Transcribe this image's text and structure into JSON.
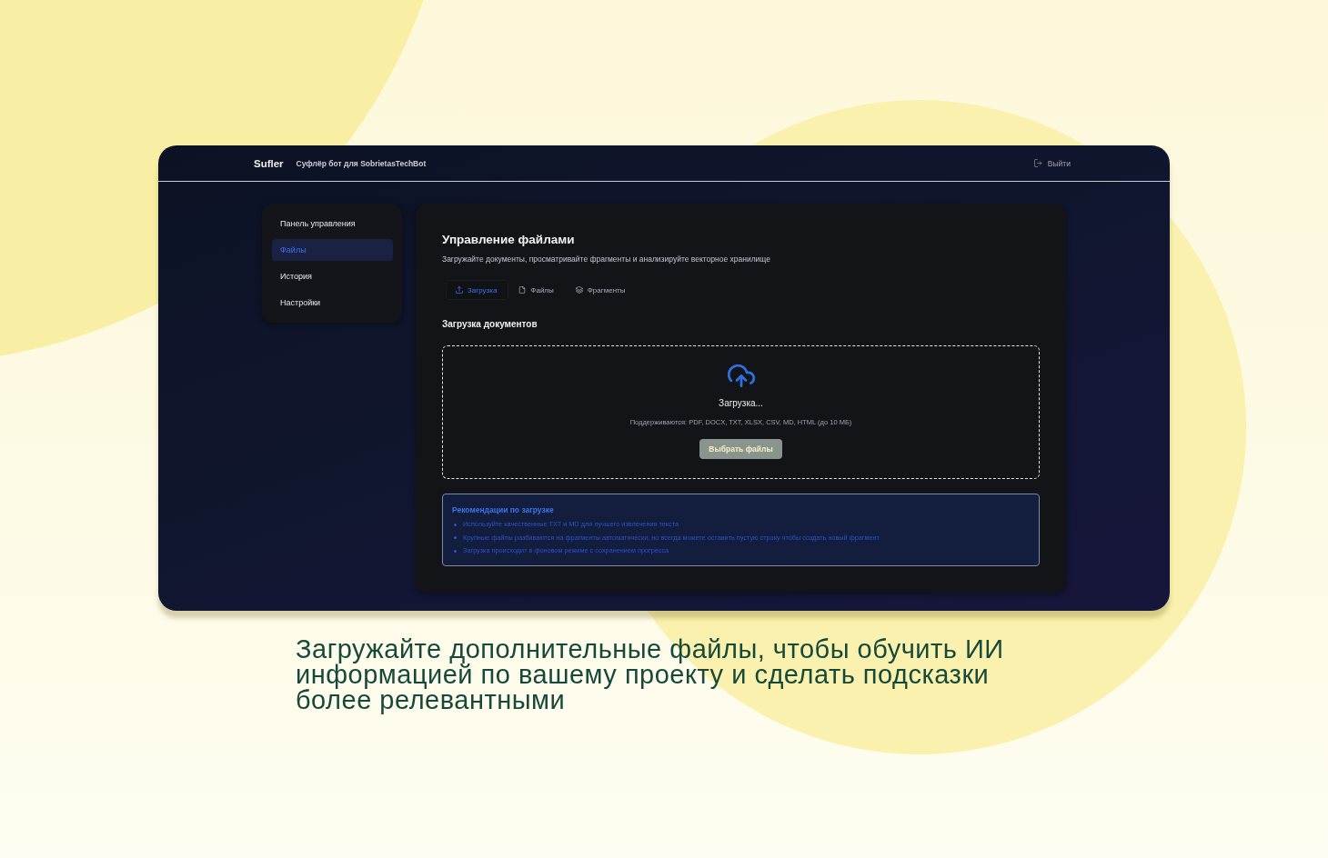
{
  "app": {
    "header": {
      "logo": "Sufler",
      "subtitle": "Суфлёр бот для SobrietasTechBot",
      "logout": "Выйти"
    },
    "sidebar": {
      "items": [
        {
          "label": "Панель управления",
          "selected": false
        },
        {
          "label": "Файлы",
          "selected": true
        },
        {
          "label": "История",
          "selected": false
        },
        {
          "label": "Настройки",
          "selected": false
        }
      ]
    },
    "main": {
      "title": "Управление файлами",
      "subtitle": "Загружайте документы, просматривайте фрагменты и анализируйте векторное хранилище",
      "tabs": [
        {
          "label": "Загрузка",
          "selected": true
        },
        {
          "label": "Файлы",
          "selected": false
        },
        {
          "label": "Фрагменты",
          "selected": false
        }
      ],
      "upload": {
        "heading": "Загрузка документов",
        "status": "Загрузка...",
        "formats": "Поддерживаются: PDF, DOCX, TXT, XLSX, CSV, MD, HTML (до 10 МБ)",
        "button": {
          "label": "Выбрать файлы",
          "disabled": true
        }
      },
      "tips": {
        "title": "Рекомендации по загрузке",
        "items": [
          "Используйте качественные TXT и MD для лучшего извлечения текста",
          "Крупные файлы разбиваются на фрагменты автоматически, но всегда можете оставить пустую строку чтобы создать новый фрагмент",
          "Загрузка происходит в фоновом режиме с сохранением прогресса"
        ]
      }
    }
  },
  "caption": "Загружайте дополнительные файлы, чтобы обучить ИИ информацией по вашему проекту и сделать подсказки более релевантными"
}
